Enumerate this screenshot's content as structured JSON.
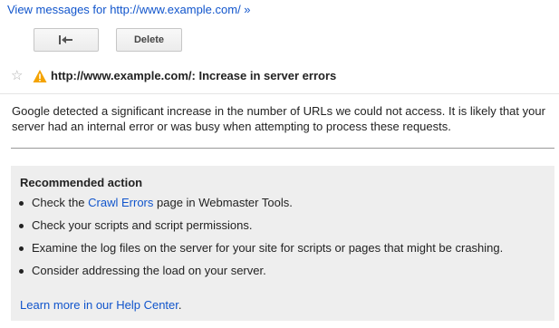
{
  "top_link": {
    "label": "View messages for http://www.example.com/ »"
  },
  "toolbar": {
    "back_icon": "back-arrow-icon",
    "delete_label": "Delete"
  },
  "message": {
    "star_icon": "star-icon",
    "warning_icon": "warning-icon",
    "warning_color": "#f4a300",
    "title": "http://www.example.com/: Increase in server errors",
    "description": "Google detected a significant increase in the number of URLs we could not access. It is likely that your server had an internal error or was busy when attempting to process these requests."
  },
  "recommended": {
    "heading": "Recommended action",
    "items": [
      {
        "before": "Check the ",
        "link": "Crawl Errors",
        "after": " page in Webmaster Tools."
      },
      {
        "before": "Check your scripts and script permissions.",
        "link": "",
        "after": ""
      },
      {
        "before": "Examine the log files on the server for your site for scripts or pages that might be crashing.",
        "link": "",
        "after": ""
      },
      {
        "before": "Consider addressing the load on your server.",
        "link": "",
        "after": ""
      }
    ],
    "help_link": "Learn more in our Help Center",
    "help_after": "."
  },
  "colors": {
    "link": "#1155cc",
    "box_background": "#eeeeee"
  }
}
